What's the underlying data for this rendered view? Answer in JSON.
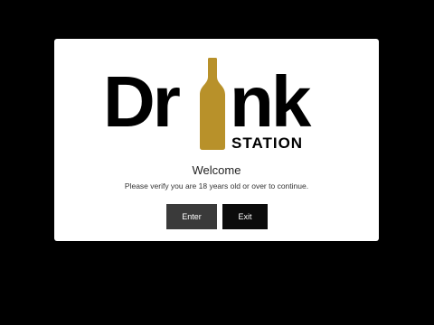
{
  "logo": {
    "word_left": "Dr",
    "word_right": "nk",
    "tagline": "STATION",
    "bottle_color": "#b8912a",
    "text_color": "#000000"
  },
  "dialog": {
    "title": "Welcome",
    "message": "Please verify you are 18 years old or over to continue.",
    "enter_label": "Enter",
    "exit_label": "Exit"
  },
  "colors": {
    "backdrop": "#000000",
    "modal_bg": "#ffffff",
    "enter_bg": "#3a3a3a",
    "exit_bg": "#0b0b0b"
  }
}
